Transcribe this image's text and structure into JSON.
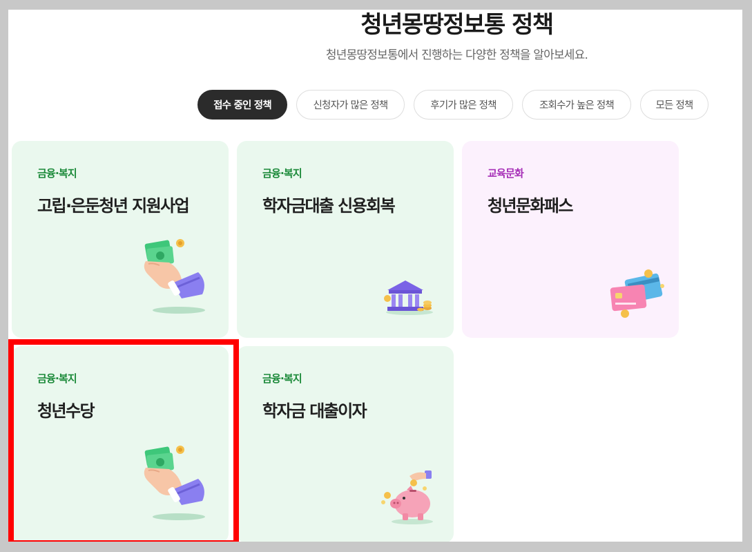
{
  "header": {
    "title": "청년몽땅정보통 정책",
    "subtitle": "청년몽땅정보통에서 진행하는 다양한 정책을 알아보세요."
  },
  "tabs": [
    {
      "label": "접수 중인 정책",
      "active": true
    },
    {
      "label": "신청자가 많은 정책",
      "active": false
    },
    {
      "label": "후기가 많은 정책",
      "active": false
    },
    {
      "label": "조회수가 높은 정책",
      "active": false
    },
    {
      "label": "모든 정책",
      "active": false
    }
  ],
  "cards": [
    {
      "category": "금융·복지",
      "name": "고립·은둔청년 지원사업",
      "icon": "hand-money-icon",
      "theme": "green"
    },
    {
      "category": "금융·복지",
      "name": "학자금대출 신용회복",
      "icon": "bank-coins-icon",
      "theme": "green"
    },
    {
      "category": "교육문화",
      "name": "청년문화패스",
      "icon": "credit-cards-icon",
      "theme": "pink"
    },
    {
      "category": "금융·복지",
      "name": "청년수당",
      "icon": "hand-money-icon",
      "theme": "green"
    },
    {
      "category": "금융·복지",
      "name": "학자금 대출이자",
      "icon": "piggy-bank-icon",
      "theme": "green"
    }
  ],
  "colors": {
    "category_green": "#1c8a3a",
    "category_purple": "#a62fb7",
    "card_green_bg": "#eaf8ee",
    "card_pink_bg": "#fcf1fd",
    "active_tab_bg": "#2b2b2b",
    "highlight": "#ff0000"
  }
}
